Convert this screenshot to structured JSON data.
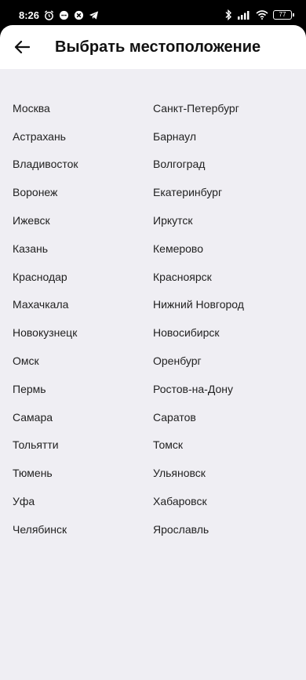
{
  "status_bar": {
    "time": "8:26",
    "battery": "77",
    "icons_left": [
      "alarm-icon",
      "chat-bubble-icon",
      "app-icon",
      "telegram-icon"
    ],
    "icons_right": [
      "bluetooth-icon",
      "signal-icon",
      "wifi-icon",
      "battery-icon"
    ]
  },
  "header": {
    "title": "Выбрать местоположение",
    "back_icon": "arrow-left-icon"
  },
  "cities": [
    "Москва",
    "Санкт-Петербург",
    "Астрахань",
    "Барнаул",
    "Владивосток",
    "Волгоград",
    "Воронеж",
    "Екатеринбург",
    "Ижевск",
    "Иркутск",
    "Казань",
    "Кемерово",
    "Краснодар",
    "Красноярск",
    "Махачкала",
    "Нижний Новгород",
    "Новокузнецк",
    "Новосибирск",
    "Омск",
    "Оренбург",
    "Пермь",
    "Ростов-на-Дону",
    "Самара",
    "Саратов",
    "Тольятти",
    "Томск",
    "Тюмень",
    "Ульяновск",
    "Уфа",
    "Хабаровск",
    "Челябинск",
    "Ярославль"
  ],
  "colors": {
    "background": "#efeef3",
    "header_bg": "#ffffff",
    "status_bg": "#000000",
    "text": "#222222"
  }
}
